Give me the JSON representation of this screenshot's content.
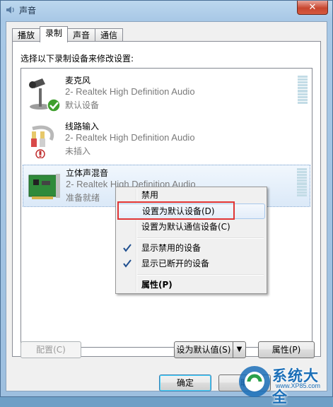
{
  "window": {
    "title": "声音",
    "close_glyph": "✕"
  },
  "tabs": [
    {
      "label": "播放",
      "active": false
    },
    {
      "label": "录制",
      "active": true
    },
    {
      "label": "声音",
      "active": false
    },
    {
      "label": "通信",
      "active": false
    }
  ],
  "panel": {
    "prompt": "选择以下录制设备来修改设置:"
  },
  "devices": [
    {
      "name": "麦克风",
      "driver": "2- Realtek High Definition Audio",
      "status": "默认设备",
      "icon": "microphone-icon"
    },
    {
      "name": "线路输入",
      "driver": "2- Realtek High Definition Audio",
      "status": "未插入",
      "icon": "line-in-icon"
    },
    {
      "name": "立体声混音",
      "driver": "2- Realtek High Definition Audio",
      "status": "准备就绪",
      "icon": "sound-card-icon",
      "selected": true
    }
  ],
  "context_menu": {
    "items": [
      {
        "label": "禁用"
      },
      {
        "label": "设置为默认设备(D)",
        "highlighted": true
      },
      {
        "label": "设置为默认通信设备(C)"
      },
      {
        "label": "显示禁用的设备",
        "checked": true
      },
      {
        "label": "显示已断开的设备",
        "checked": true
      },
      {
        "label": "属性(P)",
        "bold": true
      }
    ]
  },
  "buttons": {
    "configure": "配置(C)",
    "set_default": "设为默认值(S)",
    "properties": "属性(P)",
    "ok": "确定",
    "cancel": "取"
  },
  "watermark": {
    "text": "系统大全",
    "url": "www.XP85.com"
  },
  "colors": {
    "highlight_box": "#e03535",
    "selection": "#dbe9f8",
    "accent": "#1b6fb8"
  }
}
